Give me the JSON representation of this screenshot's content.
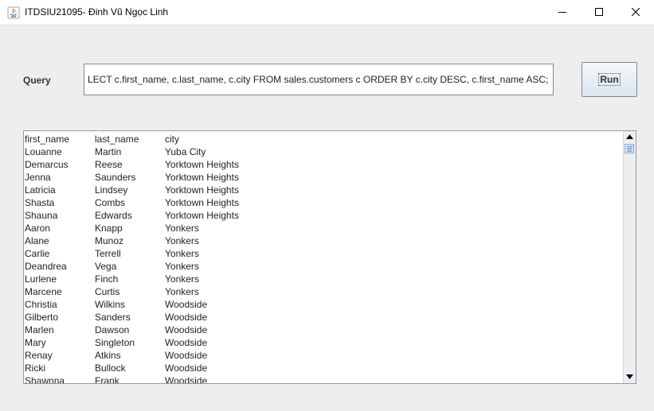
{
  "window": {
    "title": "ITDSIU21095- Đinh Vũ Ngọc Linh",
    "app_icon": "java-icon",
    "controls": [
      "minimize-icon",
      "maximize-icon",
      "close-icon"
    ]
  },
  "query": {
    "label": "Query",
    "value": "LECT c.first_name, c.last_name, c.city FROM sales.customers c ORDER BY c.city DESC, c.first_name ASC;"
  },
  "run_button": {
    "label": "Run"
  },
  "results": {
    "headers": [
      "first_name",
      "last_name",
      "city"
    ],
    "rows": [
      [
        "Louanne",
        "Martin",
        "Yuba City"
      ],
      [
        "Demarcus",
        "Reese",
        "Yorktown Heights"
      ],
      [
        "Jenna",
        "Saunders",
        "Yorktown Heights"
      ],
      [
        "Latricia",
        "Lindsey",
        "Yorktown Heights"
      ],
      [
        "Shasta",
        "Combs",
        "Yorktown Heights"
      ],
      [
        "Shauna",
        "Edwards",
        "Yorktown Heights"
      ],
      [
        "Aaron",
        "Knapp",
        "Yonkers"
      ],
      [
        "Alane",
        "Munoz",
        "Yonkers"
      ],
      [
        "Carlie",
        "Terrell",
        "Yonkers"
      ],
      [
        "Deandrea",
        "Vega",
        "Yonkers"
      ],
      [
        "Lurlene",
        "Finch",
        "Yonkers"
      ],
      [
        "Marcene",
        "Curtis",
        "Yonkers"
      ],
      [
        "Christia",
        "Wilkins",
        "Woodside"
      ],
      [
        "Gilberto",
        "Sanders",
        "Woodside"
      ],
      [
        "Marlen",
        "Dawson",
        "Woodside"
      ],
      [
        "Mary",
        "Singleton",
        "Woodside"
      ],
      [
        "Renay",
        "Atkins",
        "Woodside"
      ],
      [
        "Ricki",
        "Bullock",
        "Woodside"
      ],
      [
        "Shawnna",
        "Frank",
        "Woodside"
      ]
    ]
  },
  "scrollbar": {
    "position": 0.0
  }
}
